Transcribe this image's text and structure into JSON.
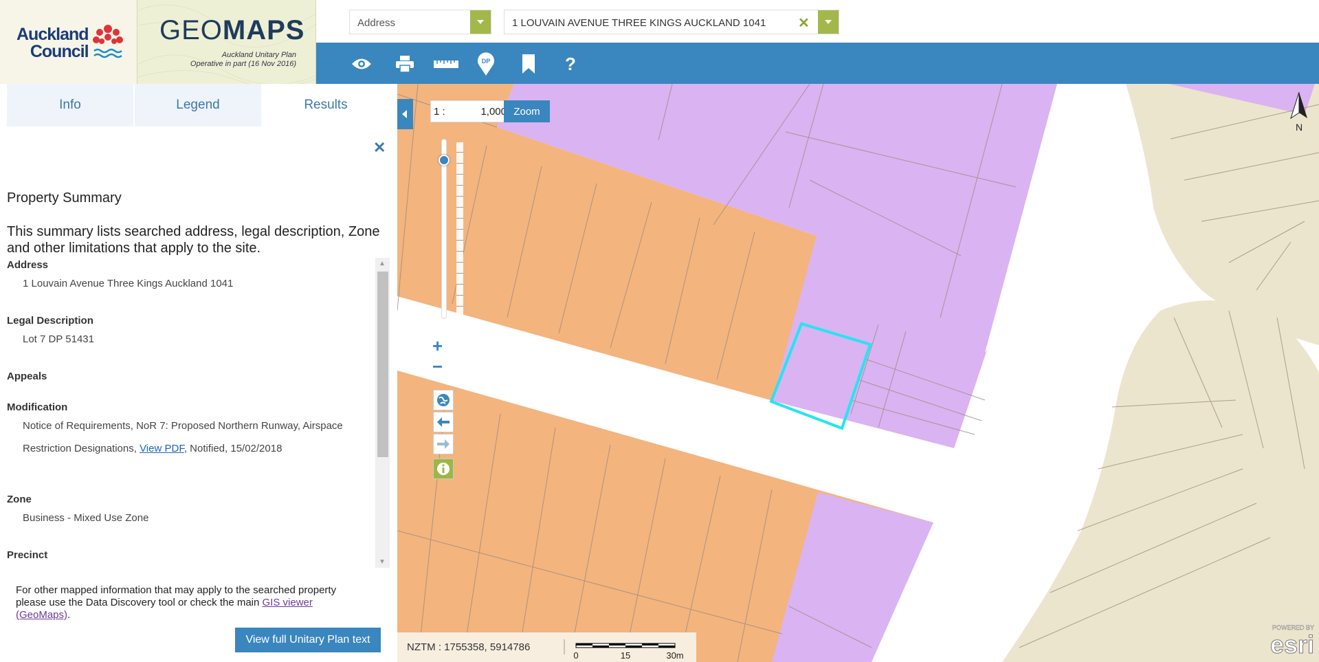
{
  "brand": {
    "council_line1": "Auckland",
    "council_line2": "Council",
    "geomaps_light": "GEO",
    "geomaps_bold": "MAPS",
    "plan_line1": "Auckland Unitary Plan",
    "plan_line2": "Operative in part (16 Nov 2016)"
  },
  "search": {
    "type_label": "Address",
    "address_value": "1 LOUVAIN AVENUE THREE KINGS AUCKLAND 1041",
    "clear_glyph": "✕"
  },
  "toolbar": {
    "tools": [
      {
        "icon": "eye-icon"
      },
      {
        "icon": "print-icon"
      },
      {
        "icon": "measure-ruler-icon"
      },
      {
        "icon": "dp-pin-icon",
        "text": "DP"
      },
      {
        "icon": "bookmark-icon"
      },
      {
        "icon": "help-icon",
        "text": "?"
      }
    ]
  },
  "panel": {
    "tabs": [
      "Info",
      "Legend",
      "Results"
    ],
    "active_tab": "Results",
    "close_glyph": "✕",
    "title": "Property Summary",
    "description": "This summary lists searched address, legal description, Zone and other limitations that apply to the site.",
    "sections": {
      "address_label": "Address",
      "address_value": "1 Louvain Avenue Three Kings Auckland 1041",
      "legal_label": "Legal Description",
      "legal_value": "Lot 7 DP 51431",
      "appeals_label": "Appeals",
      "modification_label": "Modification",
      "modification_line1": "Notice of Requirements, NoR 7: Proposed Northern Runway, Airspace",
      "modification_line2_pre": "Restriction Designations, ",
      "modification_link": "View PDF",
      "modification_line2_post": ", Notified, 15/02/2018",
      "zone_label": "Zone",
      "zone_value": "Business - Mixed Use Zone",
      "precinct_label": "Precinct"
    },
    "footer_text_pre": "For other mapped information that may apply to the searched property please use the Data Discovery tool or check the main ",
    "footer_link": "GIS viewer (GeoMaps)",
    "footer_text_post": ".",
    "view_full_button": "View full Unitary Plan text"
  },
  "map": {
    "scale_prefix": "1 :",
    "scale_value": "1,000",
    "zoom_button": "Zoom",
    "zoom_level": 0.12,
    "zoom_in": "+",
    "zoom_out": "−",
    "north_label": "N",
    "coords": "NZTM : 1755358, 5914786",
    "scalebar_labels": [
      "0",
      "15",
      "30m"
    ],
    "esri_powered": "POWERED BY",
    "esri_logo": "esri",
    "zone_colors": {
      "business_mixed_use": "#f3b47e",
      "business_town_centre": "#dab3f2",
      "residential": "#ece5cd",
      "selected_outline": "#22e6f0"
    }
  }
}
